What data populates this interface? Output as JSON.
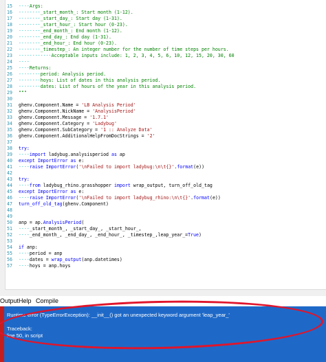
{
  "code_lines": [
    {
      "n": "15",
      "html": "<span class=\"d\">····</span><span class=\"c\">Args:</span>"
    },
    {
      "n": "16",
      "html": "<span class=\"d\">········</span><span class=\"c\">_start_month_: Start month (1-12).</span>"
    },
    {
      "n": "17",
      "html": "<span class=\"d\">········</span><span class=\"c\">_start_day_: Start day (1-31).</span>"
    },
    {
      "n": "18",
      "html": "<span class=\"d\">········</span><span class=\"c\">_start_hour_: Start hour (0-23).</span>"
    },
    {
      "n": "19",
      "html": "<span class=\"d\">········</span><span class=\"c\">_end_month_: End month (1-12).</span>"
    },
    {
      "n": "20",
      "html": "<span class=\"d\">········</span><span class=\"c\">_end_day_: End day (1-31).</span>"
    },
    {
      "n": "21",
      "html": "<span class=\"d\">········</span><span class=\"c\">_end_hour_: End hour (0-23).</span>"
    },
    {
      "n": "22",
      "html": "<span class=\"d\">········</span><span class=\"c\">_timestep_: An integer number for the number of time steps per hours.</span>"
    },
    {
      "n": "23",
      "html": "<span class=\"d\">············</span><span class=\"c\">Acceptable inputs include: 1, 2, 3, 4, 5, 6, 10, 12, 15, 20, 30, 60</span>"
    },
    {
      "n": "24",
      "html": "<span class=\"d\">····</span>"
    },
    {
      "n": "25",
      "html": "<span class=\"d\">····</span><span class=\"c\">Returns:</span>"
    },
    {
      "n": "26",
      "html": "<span class=\"d\">········</span><span class=\"c\">period: Analysis period.</span>"
    },
    {
      "n": "27",
      "html": "<span class=\"d\">········</span><span class=\"c\">hoys: List of dates in this analysis period.</span>"
    },
    {
      "n": "28",
      "html": "<span class=\"d\">········</span><span class=\"c\">dates: List of hours of the year in this analysis period.</span>"
    },
    {
      "n": "29",
      "html": "<span class=\"c\">\"\"\"</span>"
    },
    {
      "n": "30",
      "html": ""
    },
    {
      "n": "31",
      "html": "ghenv.Component.Name = <span class=\"s\">'LB Analysis Period'</span>"
    },
    {
      "n": "32",
      "html": "ghenv.Component.NickName = <span class=\"s\">'AnalysisPeriod'</span>"
    },
    {
      "n": "33",
      "html": "ghenv.Component.Message = <span class=\"s\">'1.7.1'</span>"
    },
    {
      "n": "34",
      "html": "ghenv.Component.Category = <span class=\"s\">'Ladybug'</span>"
    },
    {
      "n": "35",
      "html": "ghenv.Component.SubCategory = <span class=\"s\">'1 :: Analyze Data'</span>"
    },
    {
      "n": "36",
      "html": "ghenv.Component.AdditionalHelpFromDocStrings = <span class=\"s\">'2'</span>"
    },
    {
      "n": "37",
      "html": ""
    },
    {
      "n": "38",
      "html": "<span class=\"k\">try:</span>"
    },
    {
      "n": "39",
      "html": "<span class=\"d\">····</span><span class=\"k\">import</span> ladybug.analysisperiod <span class=\"k\">as</span> ap"
    },
    {
      "n": "40",
      "html": "<span class=\"k\">except</span> <span class=\"k\">ImportError</span> <span class=\"k\">as</span> e:"
    },
    {
      "n": "41",
      "html": "<span class=\"d\">····</span><span class=\"k\">raise</span> <span class=\"k\">ImportError</span>(<span class=\"s\">'\\nFailed to import ladybug:\\n\\t{}'</span>.<span class=\"k\">format</span>(e))"
    },
    {
      "n": "42",
      "html": ""
    },
    {
      "n": "43",
      "html": "<span class=\"k\">try:</span>"
    },
    {
      "n": "44",
      "html": "<span class=\"d\">····</span><span class=\"k\">from</span> ladybug_rhino.grasshopper <span class=\"k\">import</span> wrap_output, turn_off_old_tag"
    },
    {
      "n": "45",
      "html": "<span class=\"k\">except</span> <span class=\"k\">ImportError</span> <span class=\"k\">as</span> e:"
    },
    {
      "n": "46",
      "html": "<span class=\"d\">····</span><span class=\"k\">raise</span> <span class=\"k\">ImportError</span>(<span class=\"s\">'\\nFailed to import ladybug_rhino:\\n\\t{}'</span>.<span class=\"k\">format</span>(e))"
    },
    {
      "n": "47",
      "html": "<span class=\"k\">turn_off_old_tag</span>(ghenv.Component)"
    },
    {
      "n": "48",
      "html": ""
    },
    {
      "n": "49",
      "html": ""
    },
    {
      "n": "50",
      "html": "anp = ap.<span class=\"k\">AnalysisPeriod</span>("
    },
    {
      "n": "51",
      "html": "<span class=\"d\">····</span>_start_month_, _start_day_, _start_hour_,"
    },
    {
      "n": "52",
      "html": "<span class=\"d\">····</span>_end_month_, _end_day_, _end_hour_, _timestep_,leap_year_=<span class=\"k\">True</span>)"
    },
    {
      "n": "53",
      "html": ""
    },
    {
      "n": "54",
      "html": "<span class=\"k\">if</span> anp:"
    },
    {
      "n": "55",
      "html": "<span class=\"d\">····</span>period = anp"
    },
    {
      "n": "56",
      "html": "<span class=\"d\">····</span>dates = <span class=\"k\">wrap_output</span>(anp.datetimes)"
    },
    {
      "n": "57",
      "html": "<span class=\"d\">····</span>hoys = anp.hoys"
    }
  ],
  "menu": {
    "output": "Output",
    "help": "Help",
    "compile": "Compile"
  },
  "output_panel": {
    "error": "Runtime error (TypeErrorException): __init__() got an unexpected keyword argument 'leap_year_'",
    "traceback_label": "Traceback:",
    "traceback_line": "line 50, in script"
  },
  "colors": {
    "output_bg": "#1e69c8",
    "annotation": "#e0152b"
  }
}
